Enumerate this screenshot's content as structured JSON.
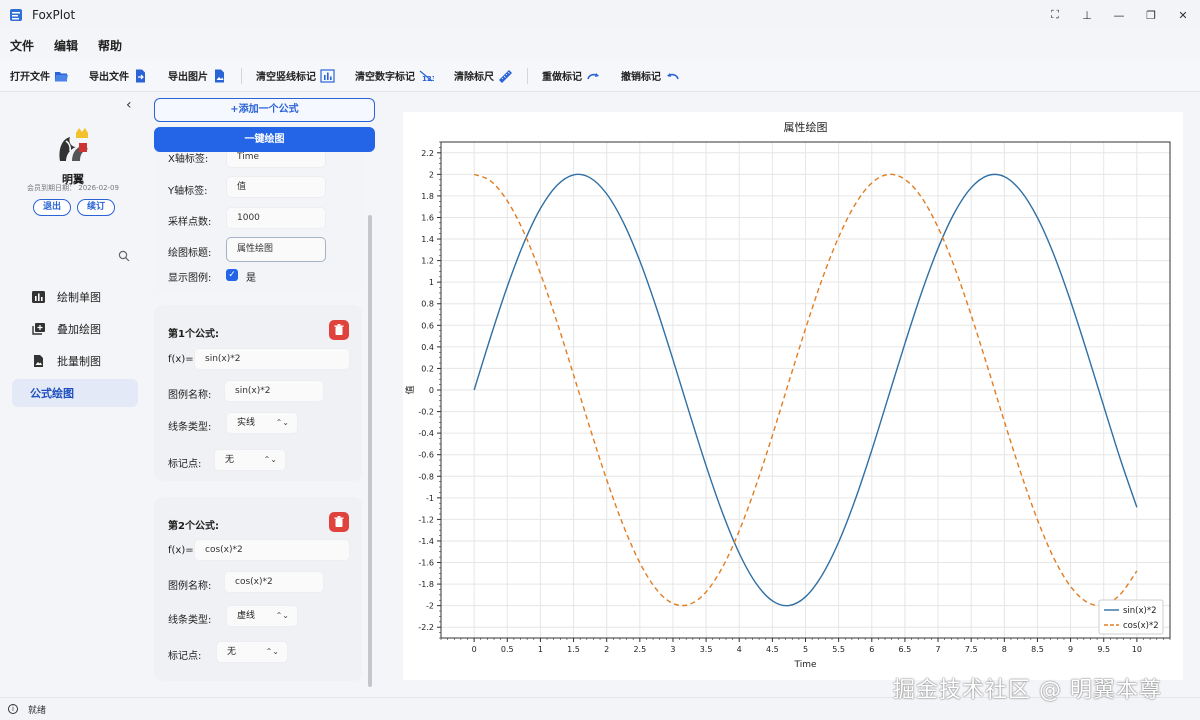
{
  "app": {
    "title": "FoxPlot"
  },
  "menu": [
    "文件",
    "编辑",
    "帮助"
  ],
  "toolbar": {
    "open_file": "打开文件",
    "export_file": "导出文件",
    "export_image": "导出图片",
    "clear_lines": "清空竖线标记",
    "clear_numbers": "清空数字标记",
    "clear_ruler": "清除标尺",
    "redo": "重做标记",
    "undo": "撤销标记"
  },
  "user": {
    "name": "明翼",
    "expire": "会员到期日期：  2026-02-09",
    "logout": "退出",
    "renew": "续订"
  },
  "nav": [
    "绘制单图",
    "叠加绘图",
    "批量制图",
    "公式绘图"
  ],
  "panel": {
    "add_formula": "+添加一个公式",
    "plot_button": "一键绘图",
    "x_label_label": "X轴标签:",
    "x_label_value": "Time",
    "y_label_label": "Y轴标签:",
    "y_label_value": "值",
    "samples_label": "采样点数:",
    "samples_value": "1000",
    "title_label": "绘图标题:",
    "title_value": "属性绘图",
    "legend_label": "显示图例:",
    "legend_value": "是",
    "formulas": [
      {
        "heading": "第1个公式:",
        "fx_label": "f(x)=",
        "expr": "sin(x)*2",
        "legend_label": "图例名称:",
        "legend": "sin(x)*2",
        "line_label": "线条类型:",
        "line": "实线",
        "marker_label": "标记点:",
        "marker": "无"
      },
      {
        "heading": "第2个公式:",
        "fx_label": "f(x)=",
        "expr": "cos(x)*2",
        "legend_label": "图例名称:",
        "legend": "cos(x)*2",
        "line_label": "线条类型:",
        "line": "虚线",
        "marker_label": "标记点:",
        "marker": "无"
      }
    ]
  },
  "status": {
    "text": "就绪"
  },
  "watermark": "掘金技术社区 @ 明翼本尊",
  "colors": {
    "accent": "#2365e6",
    "series1": "#2f6fa3",
    "series2": "#e07d22",
    "delete": "#e0433d"
  },
  "chart_data": {
    "type": "line",
    "title": "属性绘图",
    "xlabel": "Time",
    "ylabel": "值",
    "xlim": [
      -0.5,
      10.5
    ],
    "ylim": [
      -2.3,
      2.3
    ],
    "xticks": [
      0,
      0.5,
      1,
      1.5,
      2,
      2.5,
      3,
      3.5,
      4,
      4.5,
      5,
      5.5,
      6,
      6.5,
      7,
      7.5,
      8,
      8.5,
      9,
      9.5,
      10
    ],
    "xtick_labels": [
      "0",
      "0.5",
      "1",
      "1.5",
      "2",
      "2.5",
      "3",
      "3.5",
      "4",
      "4.5",
      "5",
      "5.5",
      "6",
      "6.5",
      "7",
      "7.5",
      "8",
      "8.5",
      "9",
      "9.5",
      "10"
    ],
    "yticks": [
      2.2,
      2,
      1.8,
      1.6,
      1.4,
      1.2,
      1,
      0.8,
      0.6,
      0.4,
      0.2,
      0,
      -0.2,
      -0.4,
      -0.6,
      -0.8,
      -1,
      -1.2,
      -1.4,
      -1.6,
      -1.8,
      -2,
      -2.2
    ],
    "ytick_labels": [
      "2.2",
      "2",
      "1.8",
      "1.6",
      "1.4",
      "1.2",
      "1",
      "0.8",
      "0.6",
      "0.4",
      "0.2",
      "0",
      "-0.2",
      "-0.4",
      "-0.6",
      "-0.8",
      "-1",
      "-1.2",
      "-1.4",
      "-1.6",
      "-1.8",
      "-2",
      "-2.2"
    ],
    "grid": true,
    "legend_position": "lower-right",
    "x": [
      0,
      0.25,
      0.5,
      0.75,
      1,
      1.25,
      1.5,
      1.75,
      2,
      2.25,
      2.5,
      2.75,
      3,
      3.25,
      3.5,
      3.75,
      4,
      4.25,
      4.5,
      4.75,
      5,
      5.25,
      5.5,
      5.75,
      6,
      6.25,
      6.5,
      6.75,
      7,
      7.25,
      7.5,
      7.75,
      8,
      8.25,
      8.5,
      8.75,
      9,
      9.25,
      9.5,
      9.75,
      10
    ],
    "series": [
      {
        "name": "sin(x)*2",
        "style": "solid",
        "color": "#2f6fa3",
        "values": [
          0,
          0.495,
          0.959,
          1.363,
          1.683,
          1.898,
          1.995,
          1.968,
          1.819,
          1.556,
          1.197,
          0.763,
          0.282,
          -0.216,
          -0.702,
          -1.143,
          -1.514,
          -1.79,
          -1.955,
          -1.999,
          -1.918,
          -1.717,
          -1.411,
          -1.017,
          -0.559,
          -0.064,
          0.431,
          0.901,
          1.314,
          1.646,
          1.876,
          1.989,
          1.979,
          1.845,
          1.598,
          1.251,
          0.824,
          0.347,
          -0.15,
          -0.64,
          -1.088
        ]
      },
      {
        "name": "cos(x)*2",
        "style": "dashed",
        "color": "#e07d22",
        "values": [
          2,
          1.938,
          1.755,
          1.463,
          1.081,
          0.631,
          0.141,
          -0.357,
          -0.832,
          -1.256,
          -1.602,
          -1.849,
          -1.98,
          -1.988,
          -1.873,
          -1.641,
          -1.307,
          -0.893,
          -0.422,
          0.077,
          0.567,
          1.026,
          1.417,
          1.722,
          1.92,
          1.999,
          1.953,
          1.787,
          1.508,
          1.137,
          0.694,
          0.208,
          -0.291,
          -0.771,
          -1.204,
          -1.563,
          -1.822,
          -1.968,
          -1.994,
          -1.895,
          -1.678
        ]
      }
    ]
  }
}
